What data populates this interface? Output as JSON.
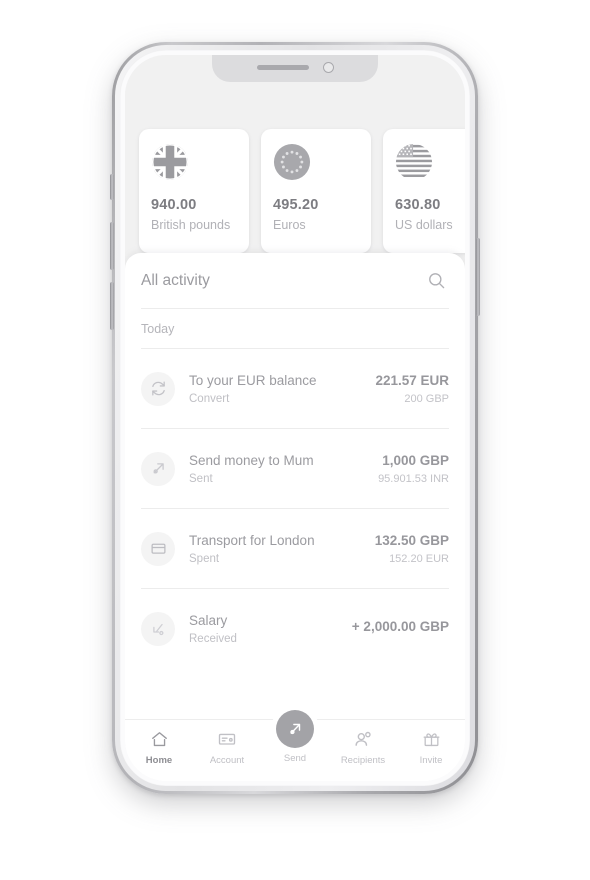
{
  "device": {
    "notch": {
      "speaker": "speaker-grille",
      "camera": "front-camera"
    },
    "side_buttons": [
      "mute-switch",
      "volume-up",
      "volume-down",
      "power"
    ]
  },
  "balances": [
    {
      "amount": "940.00",
      "label": "British pounds",
      "flag": "gb-flag-icon"
    },
    {
      "amount": "495.20",
      "label": "Euros",
      "flag": "eu-flag-icon"
    },
    {
      "amount": "630.80",
      "label": "US dollars",
      "flag": "us-flag-icon"
    }
  ],
  "activity": {
    "title": "All activity",
    "search_icon": "search-icon",
    "day_group": "Today",
    "transactions": [
      {
        "icon": "convert-icon",
        "title": "To your EUR balance",
        "subtitle": "Convert",
        "amount": "221.57 EUR",
        "secondary": "200 GBP"
      },
      {
        "icon": "send-arrow-icon",
        "title": "Send money to Mum",
        "subtitle": "Sent",
        "amount": "1,000 GBP",
        "secondary": "95.901.53 INR"
      },
      {
        "icon": "card-icon",
        "title": "Transport for London",
        "subtitle": "Spent",
        "amount": "132.50 GBP",
        "secondary": "152.20 EUR"
      },
      {
        "icon": "receive-arrow-icon",
        "title": "Salary",
        "subtitle": "Received",
        "amount": "+ 2,000.00 GBP",
        "secondary": ""
      }
    ]
  },
  "navbar": {
    "items": [
      {
        "label": "Home",
        "icon": "home-icon",
        "active": true
      },
      {
        "label": "Account",
        "icon": "account-card-icon",
        "active": false
      },
      {
        "label": "Send",
        "icon": "send-arrow-icon",
        "active": false,
        "fab": true
      },
      {
        "label": "Recipients",
        "icon": "recipients-people-icon",
        "active": false
      },
      {
        "label": "Invite",
        "icon": "gift-icon",
        "active": false
      }
    ]
  },
  "colors": {
    "screen_bg": "#f1f1f1",
    "sheet_bg": "#ffffff",
    "text_primary": "#9b9ba0",
    "text_muted": "#c0c0c5",
    "accent_grey": "#a3a3a7"
  }
}
